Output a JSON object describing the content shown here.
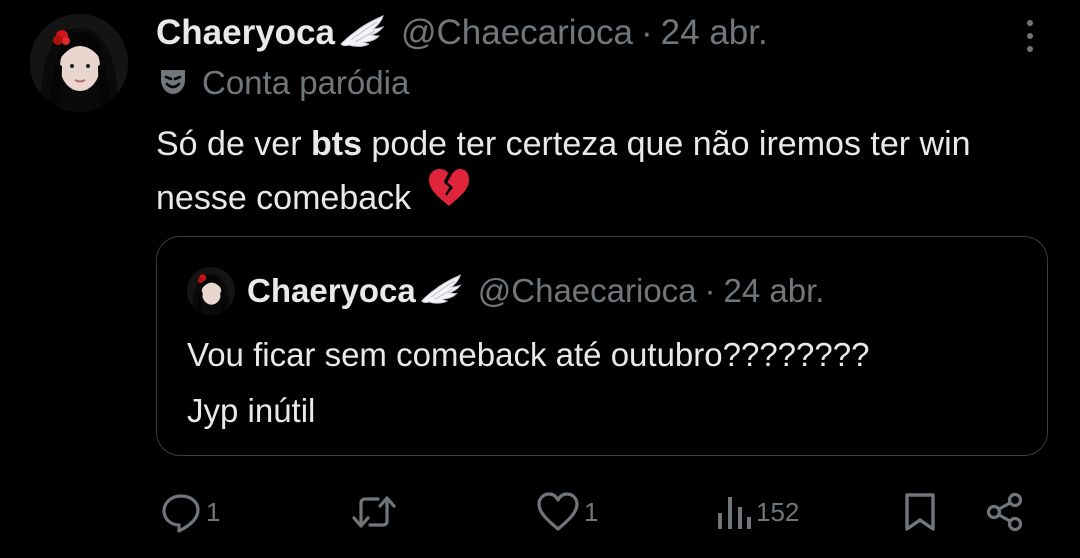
{
  "tweet": {
    "author_name": "Chaeryoca",
    "handle": "@Chaecarioca",
    "separator": "·",
    "date": "24 abr.",
    "parody_label": "Conta paródia",
    "text_before": "Só de ver ",
    "text_bold": "bts",
    "text_after": " pode ter certeza que não iremos ter win nesse comeback",
    "emoji_icon": "broken-heart-icon"
  },
  "quoted": {
    "author_name": "Chaeryoca",
    "handle": "@Chaecarioca",
    "separator": "·",
    "date": "24 abr.",
    "text_line1": "Vou ficar sem comeback até outubro????????",
    "text_line2": "Jyp inútil"
  },
  "actions": {
    "reply_count": "1",
    "retweet_count": "",
    "like_count": "1",
    "views_count": "152"
  },
  "colors": {
    "background": "#000000",
    "text": "#e7e9ea",
    "secondary": "#71767b",
    "border": "#3a3d41"
  }
}
